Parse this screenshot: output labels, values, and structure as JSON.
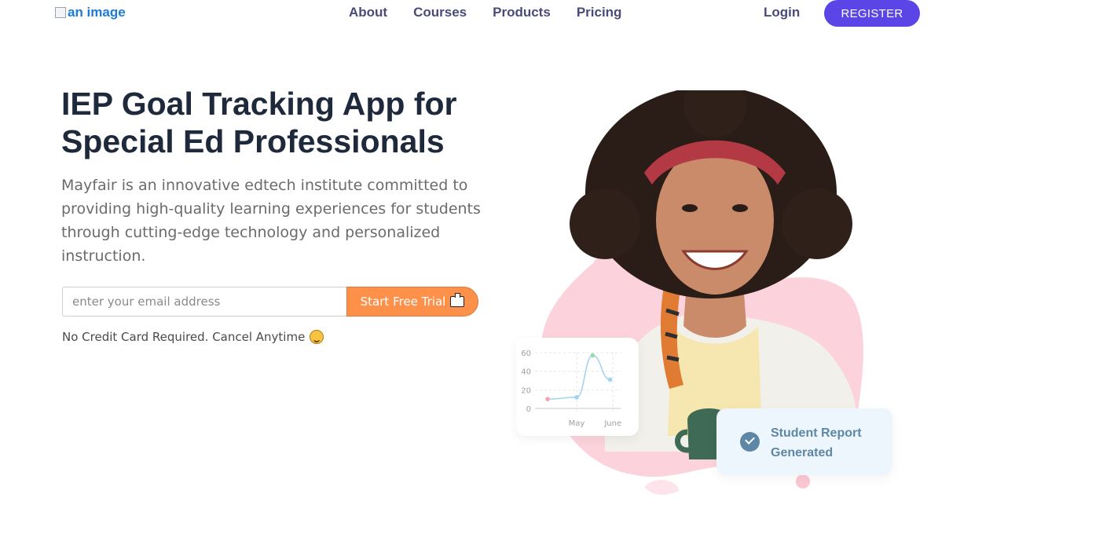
{
  "nav": {
    "logo_alt": "an image",
    "links": [
      "About",
      "Courses",
      "Products",
      "Pricing"
    ],
    "login": "Login",
    "register": "REGISTER"
  },
  "hero": {
    "title": "IEP Goal Tracking App for Special Ed Professionals",
    "subtitle": "Mayfair is an innovative edtech institute committed to providing high-quality learning experiences for students through cutting-edge technology and personalized instruction.",
    "email_placeholder": "enter your email address",
    "cta_label": "Start Free Trial",
    "cta_icon": "briefcase-icon",
    "note": "No Credit Card Required. Cancel Anytime",
    "note_icon": "praise-emoji-icon"
  },
  "report_card": {
    "text": "Student Report Generated",
    "icon": "check-circle-icon"
  },
  "chart_data": {
    "type": "line",
    "y_ticks": [
      "60",
      "40",
      "20",
      "0"
    ],
    "x_labels": [
      "May",
      "June"
    ],
    "ylim": [
      0,
      60
    ],
    "grid": true,
    "points": [
      {
        "x": 0,
        "y": 10
      },
      {
        "x": 1,
        "y": 12
      },
      {
        "x": 1.55,
        "y": 57
      },
      {
        "x": 2.15,
        "y": 31
      }
    ]
  },
  "colors": {
    "accent": "#5b45e6",
    "cta": "#fd914a",
    "heading": "#1e2a3b",
    "nav_text": "#4b4a7a",
    "report_text": "#5e87a6",
    "blob_pink": "#fcd3dc"
  }
}
